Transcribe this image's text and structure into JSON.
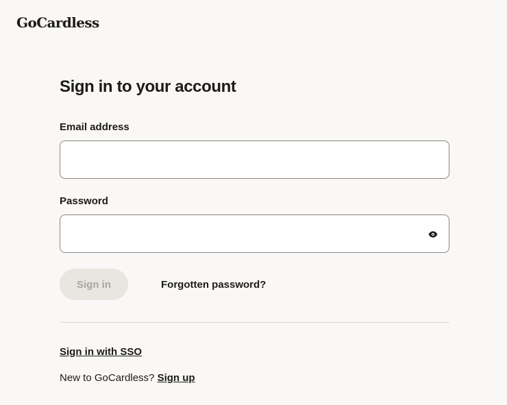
{
  "brand": {
    "logo_text": "GoCardless"
  },
  "form": {
    "title": "Sign in to your account",
    "email": {
      "label": "Email address",
      "value": "",
      "placeholder": ""
    },
    "password": {
      "label": "Password",
      "value": "",
      "placeholder": "",
      "toggle_icon": "eye-icon"
    },
    "signin_button_label": "Sign in",
    "signin_button_state": "disabled",
    "forgot_password_label": "Forgotten password?",
    "sso_label": "Sign in with SSO",
    "signup_prompt": "New to GoCardless?",
    "signup_label": "Sign up"
  },
  "colors": {
    "background": "#f9f8f6",
    "text": "#1c1b18",
    "input_border": "#8a8780",
    "disabled_button_bg": "#e8e6e1",
    "disabled_button_text": "#a8a59e",
    "divider": "#dcd9d3"
  }
}
